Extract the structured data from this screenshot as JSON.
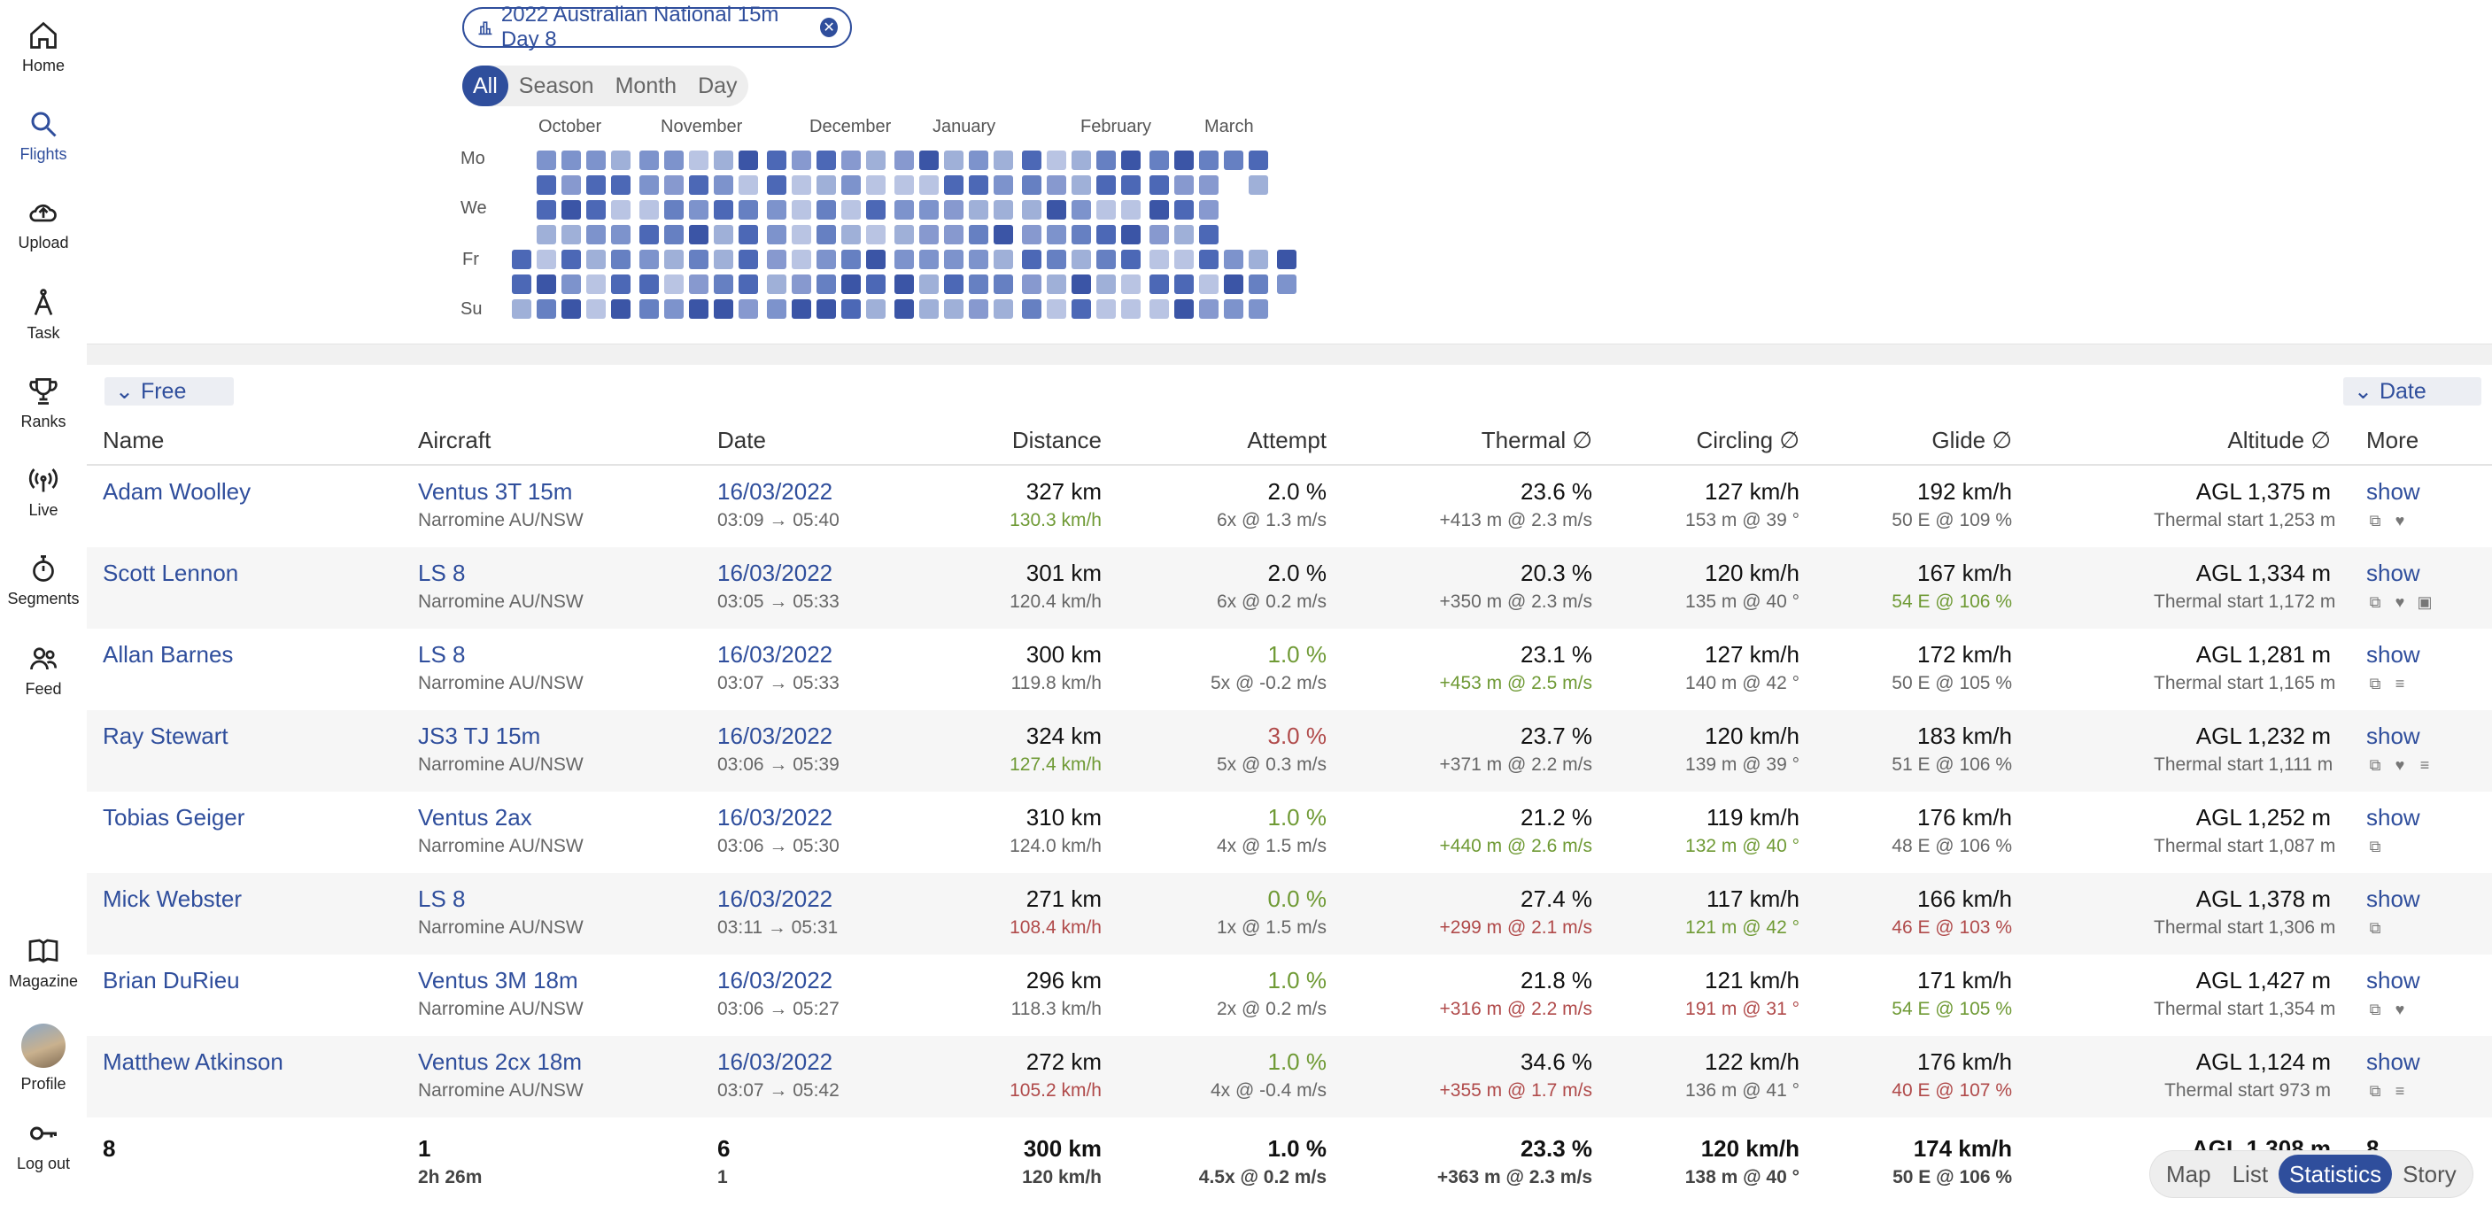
{
  "sidebar": {
    "items": [
      {
        "label": "Home",
        "icon": "home-icon"
      },
      {
        "label": "Flights",
        "icon": "search-icon"
      },
      {
        "label": "Upload",
        "icon": "upload-cloud-icon"
      },
      {
        "label": "Task",
        "icon": "compass-icon"
      },
      {
        "label": "Ranks",
        "icon": "trophy-icon"
      },
      {
        "label": "Live",
        "icon": "broadcast-icon"
      },
      {
        "label": "Segments",
        "icon": "stopwatch-icon"
      },
      {
        "label": "Feed",
        "icon": "people-icon"
      }
    ],
    "bottom": [
      {
        "label": "Magazine",
        "icon": "book-icon"
      },
      {
        "label": "Profile",
        "icon": "avatar"
      },
      {
        "label": "Log out",
        "icon": "key-icon"
      }
    ]
  },
  "filter": {
    "chip_label": "2022 Australian National 15m Day 8"
  },
  "period_tabs": [
    "All",
    "Season",
    "Month",
    "Day"
  ],
  "heatmap": {
    "months": [
      "October",
      "November",
      "December",
      "January",
      "February",
      "March"
    ],
    "days": [
      "Mo",
      "We",
      "Fr",
      "Su"
    ]
  },
  "groups": {
    "left": "Free",
    "right": "Date"
  },
  "table": {
    "headers": {
      "name": "Name",
      "aircraft": "Aircraft",
      "date": "Date",
      "distance": "Distance",
      "attempt": "Attempt",
      "thermal": "Thermal ∅",
      "circling": "Circling ∅",
      "glide": "Glide ∅",
      "altitude": "Altitude ∅",
      "more": "More"
    },
    "rows": [
      {
        "name": "Adam Woolley",
        "aircraft": "Ventus 3T 15m",
        "site": "Narromine AU/NSW",
        "date": "16/03/2022",
        "time": "03:09 → 05:40",
        "distance": "327 km",
        "speed": "130.3 km/h",
        "attempt": "2.0 %",
        "attempt_sub": "6x @ 1.3 m/s",
        "thermal": "23.6 %",
        "thermal_sub": "+413 m @ 2.3 m/s",
        "circling": "127 km/h",
        "circling_sub": "153 m @ 39 °",
        "glide": "192 km/h",
        "glide_sub": "50 E @ 109 %",
        "altitude": "AGL 1,375 m",
        "altitude_sub": "Thermal start 1,253 m",
        "more": "show"
      },
      {
        "name": "Scott Lennon",
        "aircraft": "LS 8",
        "site": "Narromine AU/NSW",
        "date": "16/03/2022",
        "time": "03:05 → 05:33",
        "distance": "301 km",
        "speed": "120.4 km/h",
        "attempt": "2.0 %",
        "attempt_sub": "6x @ 0.2 m/s",
        "thermal": "20.3 %",
        "thermal_sub": "+350 m @ 2.3 m/s",
        "circling": "120 km/h",
        "circling_sub": "135 m @ 40 °",
        "glide": "167 km/h",
        "glide_sub": "54 E @ 106 %",
        "altitude": "AGL 1,334 m",
        "altitude_sub": "Thermal start 1,172 m",
        "more": "show"
      },
      {
        "name": "Allan Barnes",
        "aircraft": "LS 8",
        "site": "Narromine AU/NSW",
        "date": "16/03/2022",
        "time": "03:07 → 05:33",
        "distance": "300 km",
        "speed": "119.8 km/h",
        "attempt": "1.0 %",
        "attempt_sub": "5x @ -0.2 m/s",
        "thermal": "23.1 %",
        "thermal_sub": "+453 m @ 2.5 m/s",
        "circling": "127 km/h",
        "circling_sub": "140 m @ 42 °",
        "glide": "172 km/h",
        "glide_sub": "50 E @ 105 %",
        "altitude": "AGL 1,281 m",
        "altitude_sub": "Thermal start 1,165 m",
        "more": "show"
      },
      {
        "name": "Ray Stewart",
        "aircraft": "JS3 TJ 15m",
        "site": "Narromine AU/NSW",
        "date": "16/03/2022",
        "time": "03:06 → 05:39",
        "distance": "324 km",
        "speed": "127.4 km/h",
        "attempt": "3.0 %",
        "attempt_sub": "5x @ 0.3 m/s",
        "thermal": "23.7 %",
        "thermal_sub": "+371 m @ 2.2 m/s",
        "circling": "120 km/h",
        "circling_sub": "139 m @ 39 °",
        "glide": "183 km/h",
        "glide_sub": "51 E @ 106 %",
        "altitude": "AGL 1,232 m",
        "altitude_sub": "Thermal start 1,111 m",
        "more": "show"
      },
      {
        "name": "Tobias Geiger",
        "aircraft": "Ventus 2ax",
        "site": "Narromine AU/NSW",
        "date": "16/03/2022",
        "time": "03:06 → 05:30",
        "distance": "310 km",
        "speed": "124.0 km/h",
        "attempt": "1.0 %",
        "attempt_sub": "4x @ 1.5 m/s",
        "thermal": "21.2 %",
        "thermal_sub": "+440 m @ 2.6 m/s",
        "circling": "119 km/h",
        "circling_sub": "132 m @ 40 °",
        "glide": "176 km/h",
        "glide_sub": "48 E @ 106 %",
        "altitude": "AGL 1,252 m",
        "altitude_sub": "Thermal start 1,087 m",
        "more": "show"
      },
      {
        "name": "Mick Webster",
        "aircraft": "LS 8",
        "site": "Narromine AU/NSW",
        "date": "16/03/2022",
        "time": "03:11 → 05:31",
        "distance": "271 km",
        "speed": "108.4 km/h",
        "attempt": "0.0 %",
        "attempt_sub": "1x @ 1.5 m/s",
        "thermal": "27.4 %",
        "thermal_sub": "+299 m @ 2.1 m/s",
        "circling": "117 km/h",
        "circling_sub": "121 m @ 42 °",
        "glide": "166 km/h",
        "glide_sub": "46 E @ 103 %",
        "altitude": "AGL 1,378 m",
        "altitude_sub": "Thermal start 1,306 m",
        "more": "show"
      },
      {
        "name": "Brian DuRieu",
        "aircraft": "Ventus 3M 18m",
        "site": "Narromine AU/NSW",
        "date": "16/03/2022",
        "time": "03:06 → 05:27",
        "distance": "296 km",
        "speed": "118.3 km/h",
        "attempt": "1.0 %",
        "attempt_sub": "2x @ 0.2 m/s",
        "thermal": "21.8 %",
        "thermal_sub": "+316 m @ 2.2 m/s",
        "circling": "121 km/h",
        "circling_sub": "191 m @ 31 °",
        "glide": "171 km/h",
        "glide_sub": "54 E @ 105 %",
        "altitude": "AGL 1,427 m",
        "altitude_sub": "Thermal start 1,354 m",
        "more": "show"
      },
      {
        "name": "Matthew Atkinson",
        "aircraft": "Ventus 2cx 18m",
        "site": "Narromine AU/NSW",
        "date": "16/03/2022",
        "time": "03:07 → 05:42",
        "distance": "272 km",
        "speed": "105.2 km/h",
        "attempt": "1.0 %",
        "attempt_sub": "4x @ -0.4 m/s",
        "thermal": "34.6 %",
        "thermal_sub": "+355 m @ 1.7 m/s",
        "circling": "122 km/h",
        "circling_sub": "136 m @ 41 °",
        "glide": "176 km/h",
        "glide_sub": "40 E @ 107 %",
        "altitude": "AGL 1,124 m",
        "altitude_sub": "Thermal start 973 m",
        "more": "show"
      }
    ],
    "summary": {
      "name": "8",
      "aircraft": "1",
      "aircraft_sub": "2h 26m",
      "date": "6",
      "date_sub": "1",
      "distance": "300 km",
      "speed": "120 km/h",
      "attempt": "1.0 %",
      "attempt_sub": "4.5x @ 0.2 m/s",
      "thermal": "23.3 %",
      "thermal_sub": "+363 m @ 2.3 m/s",
      "circling": "120 km/h",
      "circling_sub": "138 m @ 40 °",
      "glide": "174 km/h",
      "glide_sub": "50 E @ 106 %",
      "altitude": "AGL 1,308 m",
      "more": "8"
    }
  },
  "view_tabs": [
    "Map",
    "List",
    "Statistics",
    "Story"
  ],
  "colors": {
    "accent": "#2f4e9c",
    "good": "#6f9a35",
    "bad": "#b04a4a"
  }
}
